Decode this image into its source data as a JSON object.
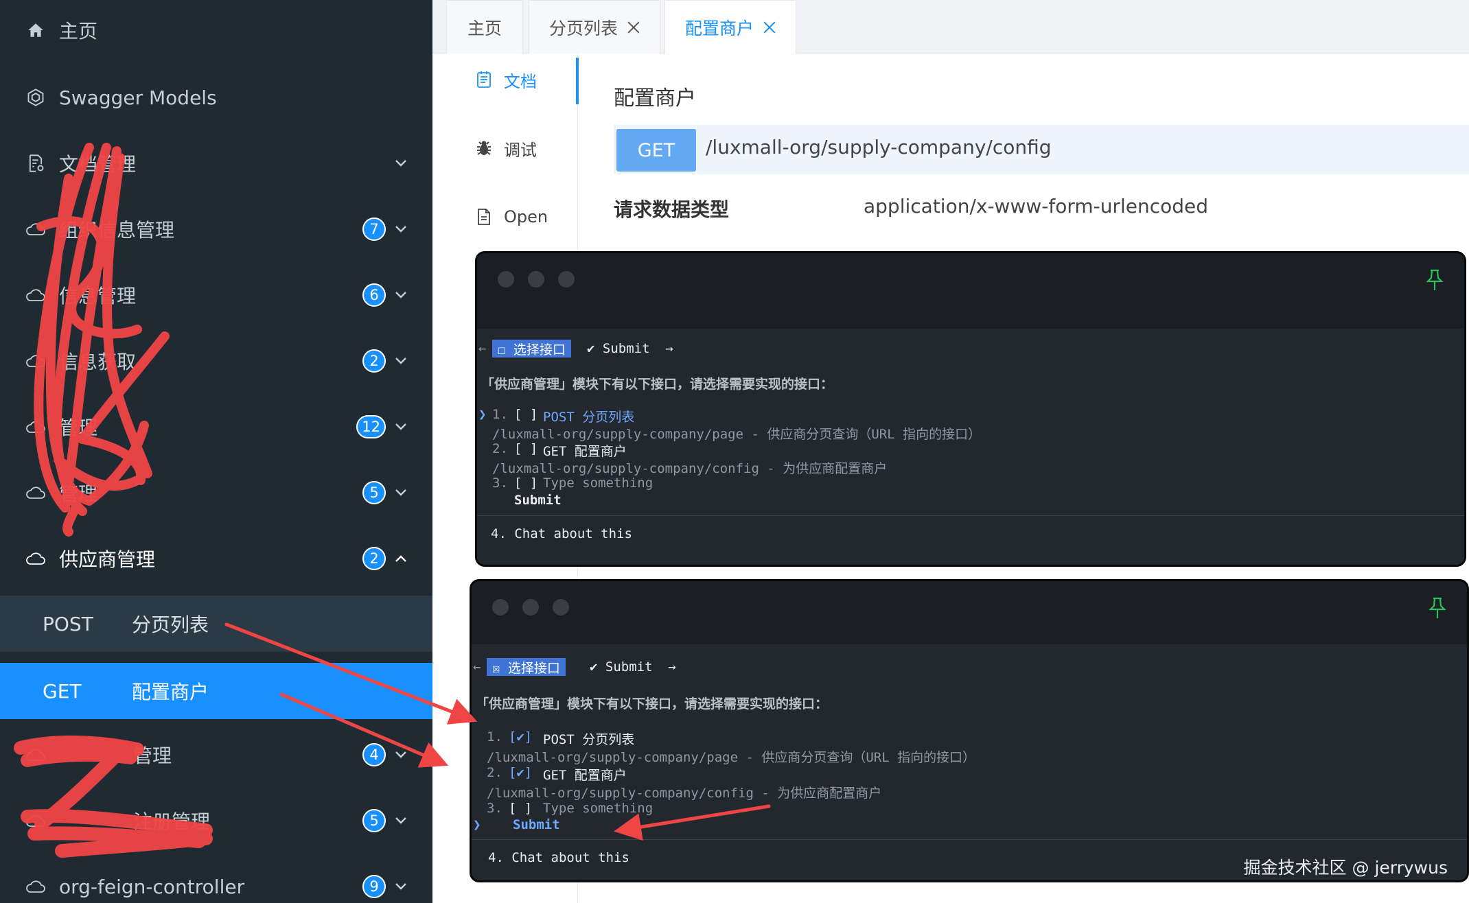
{
  "sidebar": {
    "items": [
      {
        "label": "主页",
        "icon": "home-icon"
      },
      {
        "label": "Swagger Models",
        "icon": "models-icon"
      },
      {
        "label": "文档管理",
        "icon": "doc-settings-icon"
      },
      {
        "label": "组织信息管理",
        "badge": "7",
        "icon": "cloud-api-icon"
      },
      {
        "label": "信息管理",
        "badge": "6",
        "icon": "cloud-api-icon"
      },
      {
        "label": "信息获取",
        "badge": "2",
        "icon": "cloud-api-icon"
      },
      {
        "label": "管理",
        "badge": "12",
        "icon": "cloud-api-icon"
      },
      {
        "label": "管理",
        "badge": "5",
        "icon": "cloud-api-icon"
      },
      {
        "label": "供应商管理",
        "badge": "2",
        "icon": "cloud-api-icon"
      },
      {
        "label": "管理",
        "badge": "4",
        "icon": "cloud-api-icon"
      },
      {
        "label": "注册管理",
        "badge": "5",
        "icon": "cloud-api-icon"
      },
      {
        "label": "org-feign-controller",
        "badge": "9",
        "icon": "cloud-api-icon"
      }
    ],
    "sub_items": [
      {
        "method": "POST",
        "name": "分页列表"
      },
      {
        "method": "GET",
        "name": "配置商户"
      }
    ]
  },
  "tabs": [
    {
      "label": "主页"
    },
    {
      "label": "分页列表"
    },
    {
      "label": "配置商户"
    }
  ],
  "docnav": [
    {
      "label": "文档",
      "icon": "document-icon"
    },
    {
      "label": "调试",
      "icon": "bug-icon"
    },
    {
      "label": "Open",
      "icon": "file-icon"
    }
  ],
  "api": {
    "title": "配置商户",
    "method": "GET",
    "path": "/luxmall-org/supply-company/config",
    "req_type_label": "请求数据类型",
    "req_type_value": "application/x-www-form-urlencoded"
  },
  "terminals": [
    {
      "nav_back": "←",
      "chip": "☐ 选择接口",
      "submit": "✔ Submit  →",
      "prompt": "「供应商管理」模块下有以下接口，请选择需要实现的接口：",
      "cursor": "❯",
      "opt1_num": "1.",
      "opt1_box": "[ ]",
      "opt1_text": "POST 分页列表",
      "opt1_desc": "/luxmall-org/supply-company/page - 供应商分页查询（URL 指向的接口）",
      "opt2_num": "2.",
      "opt2_box": "[ ]",
      "opt2_text": "GET 配置商户",
      "opt2_desc": "/luxmall-org/supply-company/config - 为供应商配置商户",
      "opt3_num": "3.",
      "opt3_box": "[ ]",
      "opt3_text": "Type something",
      "submit_line": "Submit",
      "chat": "4. Chat about this"
    },
    {
      "nav_back": "←",
      "chip": "☒ 选择接口",
      "submit": "✔ Submit  →",
      "prompt": "「供应商管理」模块下有以下接口，请选择需要实现的接口：",
      "cursor": "❯",
      "opt1_num": "1.",
      "opt1_box": "[✔]",
      "opt1_text": "POST 分页列表",
      "opt1_desc": "/luxmall-org/supply-company/page - 供应商分页查询（URL 指向的接口）",
      "opt2_num": "2.",
      "opt2_box": "[✔]",
      "opt2_text": "GET 配置商户",
      "opt2_desc": "/luxmall-org/supply-company/config - 为供应商配置商户",
      "opt3_num": "3.",
      "opt3_box": "[ ]",
      "opt3_text": "Type something",
      "submit_line": "Submit",
      "chat": "4. Chat about this"
    }
  ],
  "watermark": "掘金技术社区 @ jerrywus",
  "colors": {
    "accent": "#1890ff",
    "sidebar_bg": "#1f2a33",
    "annotation": "#f04545",
    "terminal_bg": "#22282e"
  }
}
